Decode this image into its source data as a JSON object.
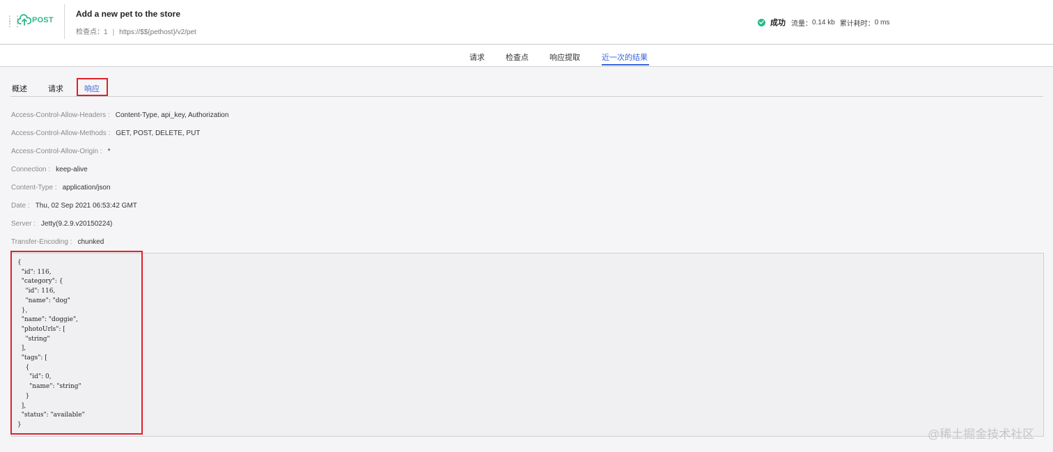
{
  "header": {
    "logo_text": "POST",
    "title": "Add a new pet to the store",
    "checkpoints_label": "检查点：",
    "checkpoints_count": "1",
    "separator": "|",
    "url": "https://$${pethost}/v2/pet",
    "status_text": "成功",
    "traffic_label": "流量：",
    "traffic_value": "0.14 kb",
    "elapsed_label": "累计耗时：",
    "elapsed_value": "0 ms",
    "status_color": "#2ab98a"
  },
  "top_tabs": [
    "请求",
    "检查点",
    "响应提取",
    "近一次的结果"
  ],
  "active_top_tab": "近一次的结果",
  "sub_tabs": [
    "概述",
    "请求",
    "响应"
  ],
  "active_sub_tab": "响应",
  "response_headers": [
    {
      "key": "Access-Control-Allow-Headers :",
      "value": "Content-Type, api_key, Authorization"
    },
    {
      "key": "Access-Control-Allow-Methods :",
      "value": "GET, POST, DELETE, PUT"
    },
    {
      "key": "Access-Control-Allow-Origin :",
      "value": "*"
    },
    {
      "key": "Connection :",
      "value": "keep-alive"
    },
    {
      "key": "Content-Type :",
      "value": "application/json"
    },
    {
      "key": "Date :",
      "value": "Thu, 02 Sep 2021 06:53:42 GMT"
    },
    {
      "key": "Server :",
      "value": "Jetty(9.2.9.v20150224)"
    },
    {
      "key": "Transfer-Encoding :",
      "value": "chunked"
    }
  ],
  "response_body": "{\n  \"id\": 116,\n  \"category\": {\n    \"id\": 116,\n    \"name\": \"dog\"\n  },\n  \"name\": \"doggie\",\n  \"photoUrls\": [\n    \"string\"\n  ],\n  \"tags\": [\n    {\n      \"id\": 0,\n      \"name\": \"string\"\n    }\n  ],\n  \"status\": \"available\"\n}",
  "watermark": "@稀土掘金技术社区",
  "colors": {
    "accent": "#3b64d8",
    "highlight": "#e0202a",
    "success": "#2ab98a"
  }
}
